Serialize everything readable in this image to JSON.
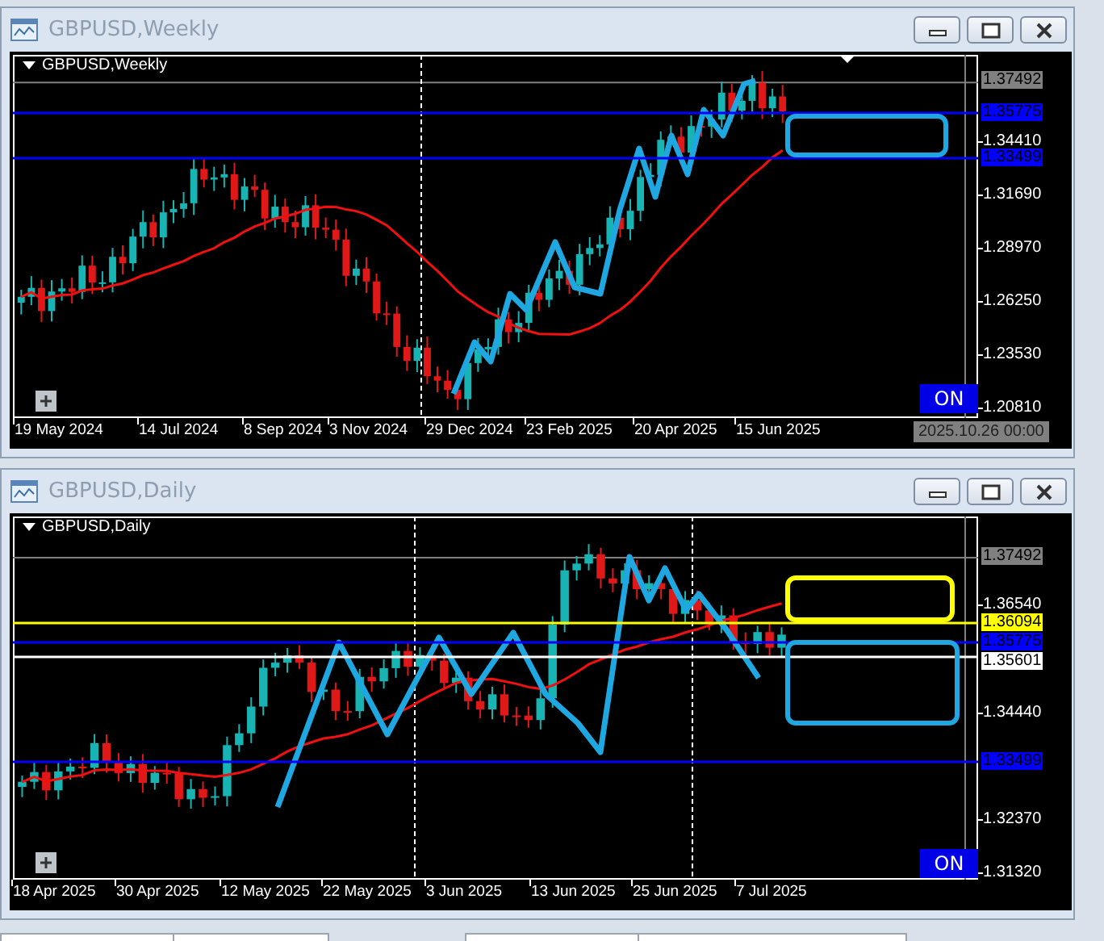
{
  "windows": [
    {
      "title": "GBPUSD,Weekly",
      "symbol_label": "GBPUSD,Weekly",
      "price_ticks": [
        "1.34410",
        "1.31690",
        "1.28970",
        "1.26250",
        "1.23530",
        "1.20810"
      ],
      "price_tags": [
        {
          "text": "1.37492",
          "color": "#808080"
        },
        {
          "text": "1.35775",
          "color": "#0000ff"
        },
        {
          "text": "1.33499",
          "color": "#0000ff"
        }
      ],
      "dates": [
        "19 May 2024",
        "14 Jul 2024",
        "8 Sep 2024",
        "3 Nov 2024",
        "29 Dec 2024",
        "23 Feb 2025",
        "20 Apr 2025",
        "15 Jun 2025"
      ],
      "time_label": "2025.10.26 00:00",
      "on_button": "ON"
    },
    {
      "title": "GBPUSD,Daily",
      "symbol_label": "GBPUSD,Daily",
      "price_ticks": [
        "1.36540",
        "1.34440",
        "1.32370",
        "1.31320"
      ],
      "price_tags": [
        {
          "text": "1.37492",
          "color": "#808080"
        },
        {
          "text": "1.36094",
          "color": "#ffff00"
        },
        {
          "text": "1.35775",
          "color": "#0000ff"
        },
        {
          "text": "1.35601",
          "color": "#ffffff"
        },
        {
          "text": "1.33499",
          "color": "#0000ff"
        }
      ],
      "dates": [
        "18 Apr 2025",
        "30 Apr 2025",
        "12 May 2025",
        "22 May 2025",
        "3 Jun 2025",
        "13 Jun 2025",
        "25 Jun 2025",
        "7 Jul 2025"
      ],
      "on_button": "ON"
    }
  ]
}
